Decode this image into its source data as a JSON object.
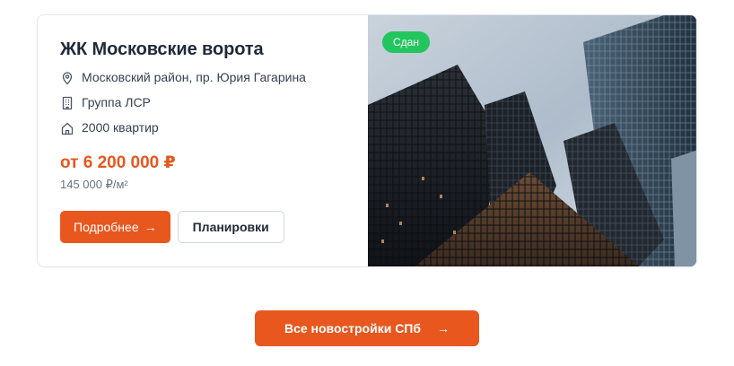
{
  "card": {
    "title": "ЖК Московские ворота",
    "address": "Московский район, пр. Юрия Гагарина",
    "developer": "Группа ЛСР",
    "apartments": "2000 квартир",
    "price": "от 6 200 000 ₽",
    "price_per_sqm": "145 000 ₽/м²",
    "details_label": "Подробнее",
    "layouts_label": "Планировки",
    "status_badge": "Сдан"
  },
  "footer": {
    "all_button_label": "Все новостройки СПб"
  },
  "icons": {
    "address": "map-pin-icon",
    "developer": "building-icon",
    "apartments": "home-icon",
    "arrow": "arrow-right-icon"
  },
  "colors": {
    "accent": "#e8571e",
    "badge": "#22c55e"
  }
}
